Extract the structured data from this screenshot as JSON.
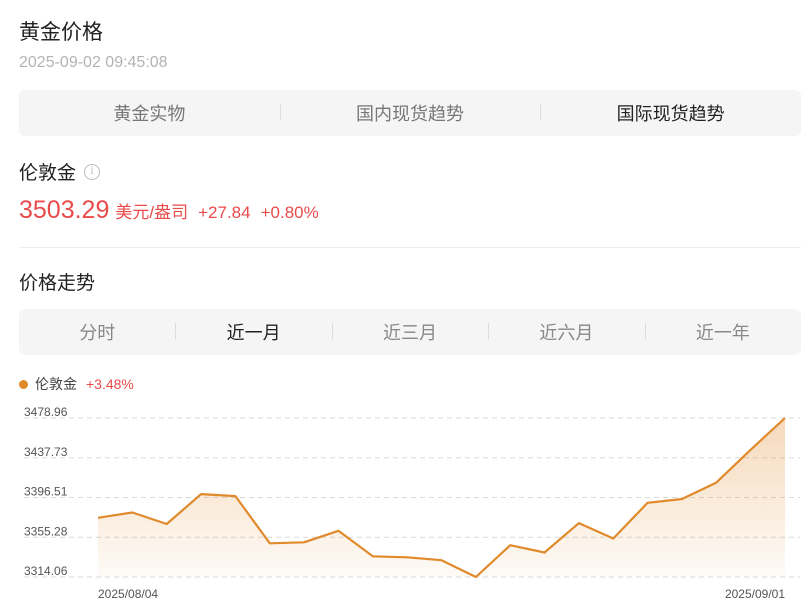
{
  "header": {
    "title": "黄金价格",
    "timestamp": "2025-09-02 09:45:08"
  },
  "tabs": [
    {
      "label": "黄金实物",
      "active": false
    },
    {
      "label": "国内现货趋势",
      "active": false
    },
    {
      "label": "国际现货趋势",
      "active": true
    }
  ],
  "gold": {
    "name": "伦敦金",
    "info_icon": "info-circle-icon",
    "price": "3503.29",
    "unit": "美元/盎司",
    "change": "+27.84",
    "change_pct": "+0.80%",
    "color_up": "#e94b4b"
  },
  "trend": {
    "title": "价格走势",
    "ranges": [
      {
        "label": "分时",
        "active": false
      },
      {
        "label": "近一月",
        "active": true
      },
      {
        "label": "近三月",
        "active": false
      },
      {
        "label": "近六月",
        "active": false
      },
      {
        "label": "近一年",
        "active": false
      }
    ],
    "legend_name": "伦敦金",
    "legend_pct": "+3.48%"
  },
  "chart_data": {
    "type": "area",
    "color": "#e08a2b",
    "y_ticks": [
      "3478.96",
      "3437.73",
      "3396.51",
      "3355.28",
      "3314.06"
    ],
    "ylim": [
      3314.06,
      3478.96
    ],
    "x_labels": [
      "2025/08/04",
      "2025/09/01"
    ],
    "grid": "horizontal dashed",
    "series": [
      {
        "values": [
          3375.5,
          3381,
          3369,
          3400,
          3398,
          3349,
          3350,
          3362,
          3335.5,
          3334.5,
          3331.5,
          3314.06,
          3347,
          3339.5,
          3370,
          3354,
          3391,
          3395,
          3412,
          3446,
          3478.96
        ]
      }
    ]
  }
}
